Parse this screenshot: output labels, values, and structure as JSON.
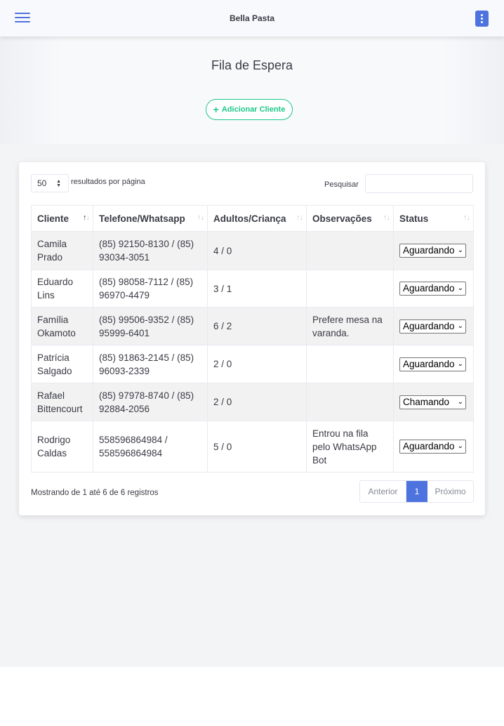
{
  "app": {
    "brand": "Bella Pasta"
  },
  "page": {
    "title": "Fila de Espera",
    "add_button": "Adicionar Cliente"
  },
  "table_controls": {
    "page_length": "50",
    "page_length_label": "resultados por página",
    "search_label": "Pesquisar",
    "search_value": ""
  },
  "columns": [
    "Cliente",
    "Telefone/Whatsapp",
    "Adultos/Criança",
    "Observações",
    "Status"
  ],
  "rows": [
    {
      "cliente": "Camila Prado",
      "telefone": "(85) 92150-8130 / (85) 93034-3051",
      "pessoas": "4 / 0",
      "obs": "",
      "status": "Aguardando"
    },
    {
      "cliente": "Eduardo Lins",
      "telefone": "(85) 98058-7112 / (85) 96970-4479",
      "pessoas": "3 / 1",
      "obs": "",
      "status": "Aguardando"
    },
    {
      "cliente": "Família Okamoto",
      "telefone": "(85) 99506-9352 / (85) 95999-6401",
      "pessoas": "6 / 2",
      "obs": "Prefere mesa na varanda.",
      "status": "Aguardando"
    },
    {
      "cliente": "Patrícia Salgado",
      "telefone": "(85) 91863-2145 / (85) 96093-2339",
      "pessoas": "2 / 0",
      "obs": "",
      "status": "Aguardando"
    },
    {
      "cliente": "Rafael Bittencourt",
      "telefone": "(85) 97978-8740 / (85) 92884-2056",
      "pessoas": "2 / 0",
      "obs": "",
      "status": "Chamando"
    },
    {
      "cliente": "Rodrigo Caldas",
      "telefone": "558596864984 / 558596864984",
      "pessoas": "5 / 0",
      "obs": "Entrou na fila pelo WhatsApp Bot",
      "status": "Aguardando"
    }
  ],
  "footer": {
    "info": "Mostrando de 1 até 6 de 6 registros",
    "prev": "Anterior",
    "current_page": "1",
    "next": "Próximo"
  },
  "icons": {
    "menu": "hamburger-menu-icon",
    "more": "kebab-menu-icon",
    "add": "plus-icon"
  },
  "colors": {
    "primary": "#4e73df",
    "success": "#1cc88a"
  }
}
